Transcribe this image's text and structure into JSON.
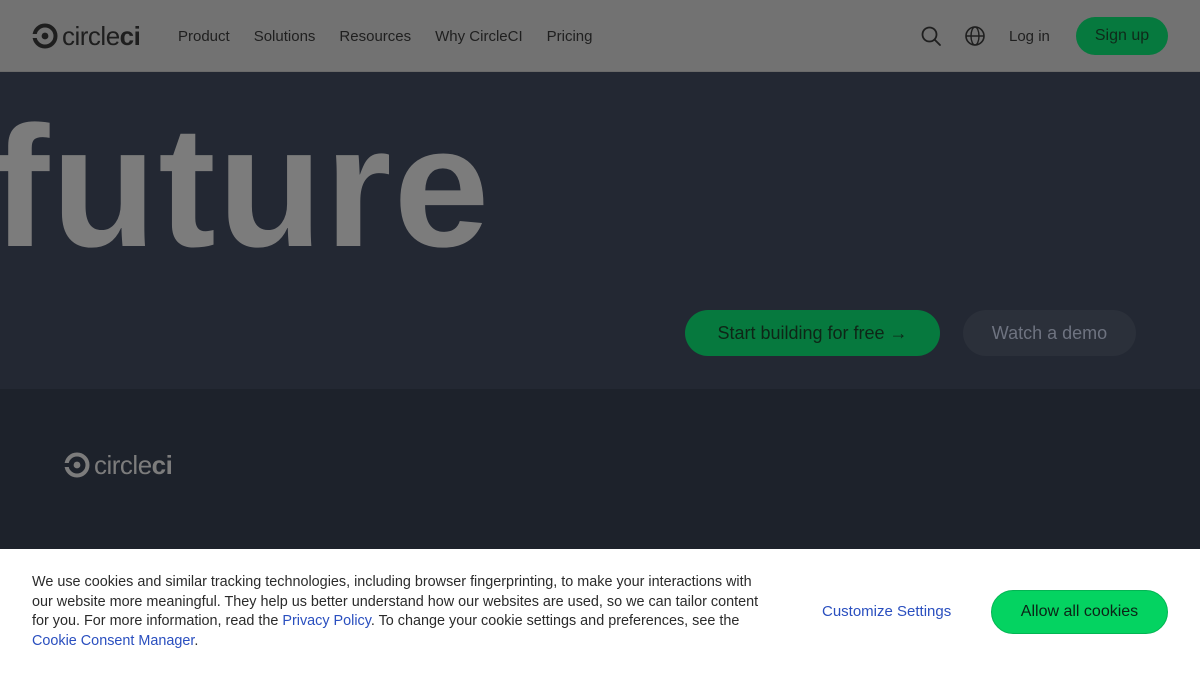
{
  "header": {
    "logo_text_light": "circle",
    "logo_text_bold": "ci",
    "nav": [
      "Product",
      "Solutions",
      "Resources",
      "Why CircleCI",
      "Pricing"
    ],
    "icons": [
      "search-icon",
      "globe-icon"
    ],
    "login_label": "Log in",
    "signup_label": "Sign up"
  },
  "hero": {
    "headline_word": "future",
    "cta_primary_label": "Start building for free →",
    "cta_secondary_label": "Watch a demo"
  },
  "footer": {
    "logo_text_light": "circle",
    "logo_text_bold": "ci"
  },
  "cookie_banner": {
    "text_1": "We use cookies and similar tracking technologies, including browser fingerprinting, to make your interactions with our website more meaningful. They help us better understand how our websites are used, so we can tailor content for you. For more information, read the ",
    "privacy_link": "Privacy Policy",
    "text_2": ". To change your cookie settings and preferences, see the ",
    "consent_link": "Cookie Consent Manager",
    "text_3": ".",
    "customize_label": "Customize Settings",
    "allow_label": "Allow all cookies"
  },
  "colors": {
    "header_bg": "#727272",
    "hero_bg": "#232833",
    "footer_bg": "#1d222b",
    "brand_green": "#06793e",
    "bright_green": "#04d361",
    "link_blue": "#2a4fbf"
  }
}
